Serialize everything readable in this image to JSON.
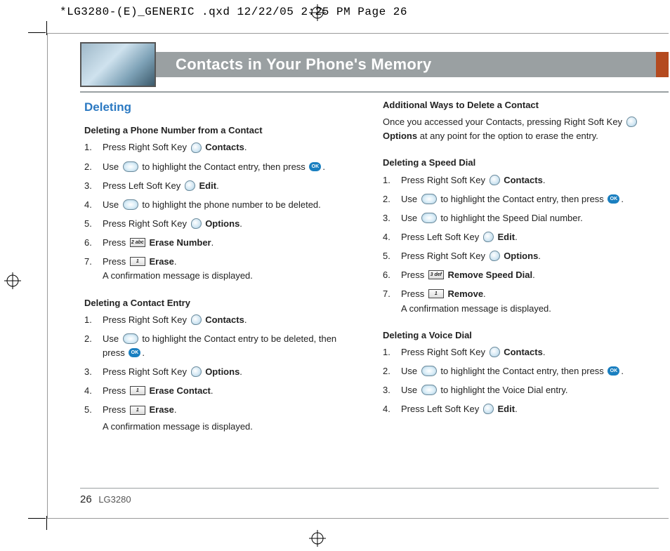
{
  "meta": {
    "printer_mark": "*LG3280-(E)_GENERIC .qxd  12/22/05  2:25 PM  Page 26"
  },
  "header": {
    "title": "Contacts in Your Phone's Memory"
  },
  "left": {
    "heading": "Deleting",
    "s1_title": "Deleting a Phone Number from a Contact",
    "s1_1a": "Press Right Soft Key ",
    "s1_1b": "Contacts",
    "s1_2a": "Use ",
    "s1_2b": " to highlight the Contact entry, then press ",
    "s1_3a": "Press Left Soft Key ",
    "s1_3b": "Edit",
    "s1_4a": "Use ",
    "s1_4b": " to highlight the phone number to be deleted.",
    "s1_5a": "Press Right Soft Key ",
    "s1_5b": "Options",
    "s1_6a": "Press ",
    "s1_6b": "Erase Number",
    "s1_7a": "Press ",
    "s1_7b": "Erase",
    "s1_7c": "A confirmation message is displayed.",
    "s2_title": "Deleting a Contact Entry",
    "s2_1a": "Press Right Soft Key ",
    "s2_1b": "Contacts",
    "s2_2a": "Use ",
    "s2_2b": " to highlight the Contact entry to be deleted, then press ",
    "s2_3a": "Press Right Soft Key ",
    "s2_3b": "Options",
    "s2_4a": "Press ",
    "s2_4b": "Erase Contact",
    "s2_5a": "Press ",
    "s2_5b": "Erase",
    "s2_5c": "A confirmation message is displayed."
  },
  "right": {
    "s3_title": "Additional Ways to Delete a Contact",
    "s3_body_a": "Once you accessed your Contacts, pressing Right Soft Key ",
    "s3_body_b": "Options",
    "s3_body_c": " at any point for the option to erase the entry.",
    "s4_title": "Deleting a Speed Dial",
    "s4_1a": "Press Right Soft Key ",
    "s4_1b": "Contacts",
    "s4_2a": "Use ",
    "s4_2b": " to highlight the Contact entry, then press ",
    "s4_3a": "Use ",
    "s4_3b": " to highlight the Speed Dial number.",
    "s4_4a": "Press Left Soft Key ",
    "s4_4b": "Edit",
    "s4_5a": "Press Right Soft Key ",
    "s4_5b": "Options",
    "s4_6a": "Press ",
    "s4_6b": "Remove Speed Dial",
    "s4_7a": "Press ",
    "s4_7b": "Remove",
    "s4_7c": "A confirmation message is displayed.",
    "s5_title": "Deleting a Voice Dial",
    "s5_1a": "Press Right Soft Key ",
    "s5_1b": "Contacts",
    "s5_2a": "Use ",
    "s5_2b": " to highlight the Contact entry, then press ",
    "s5_3a": "Use ",
    "s5_3b": " to highlight the Voice Dial entry.",
    "s5_4a": "Press Left Soft Key ",
    "s5_4b": "Edit"
  },
  "keys": {
    "k1": "1",
    "k2": "2 abc",
    "k3": "3 def",
    "ok": "OK"
  },
  "footer": {
    "page": "26",
    "model": "LG3280"
  }
}
